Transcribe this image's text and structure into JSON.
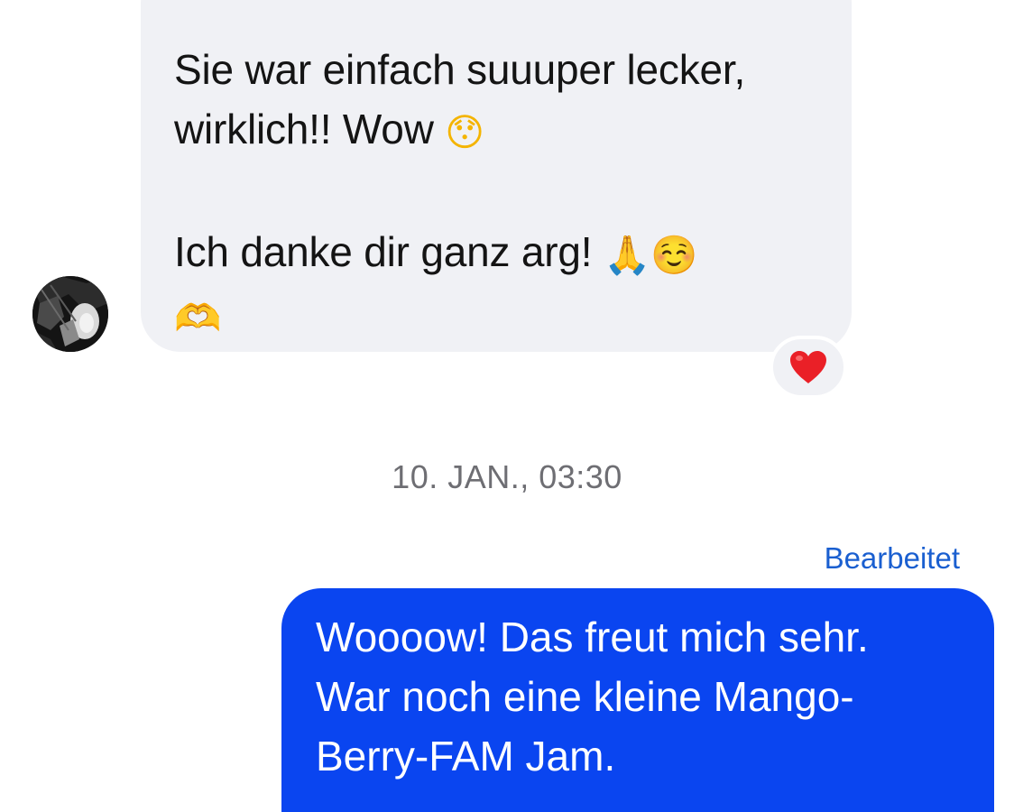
{
  "incoming_message": {
    "line1": "Sie war einfach suuuper lecker,",
    "line2_text": "wirklich!!  Wow ",
    "line2_emoji": "😯",
    "line3_text": " Ich danke dir ganz arg! ",
    "line3_emoji_pray": "🙏",
    "line3_emoji_smile": "☺️",
    "line4_emoji": "🫶"
  },
  "reaction": {
    "emoji": "❤️",
    "icon": "heart-icon",
    "color": "#ea2027"
  },
  "timestamp": "10. JAN., 03:30",
  "outgoing_message": {
    "edited_label": "Bearbeitet",
    "line1": "Woooow! Das freut mich sehr.",
    "line2": "War noch eine kleine Mango-",
    "line3": "Berry-FAM Jam."
  },
  "colors": {
    "incoming_bubble": "#f0f1f5",
    "outgoing_bubble": "#0a45f0",
    "edited_label": "#1a5fd0",
    "timestamp": "#6e6e73"
  }
}
